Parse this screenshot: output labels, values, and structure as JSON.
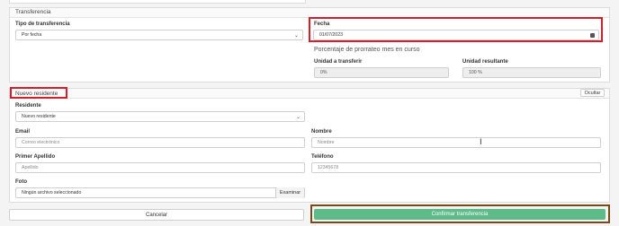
{
  "transfer": {
    "section_title": "Transferencia",
    "tipo_label": "Tipo de transferencia",
    "tipo_value": "Por fecha",
    "fecha_label": "Fecha",
    "fecha_value": "01/07/2023",
    "prorrateo_text": "Porcentaje de prorrateo mes en curso",
    "unidad_transferir_label": "Unidad a transferir",
    "unidad_transferir_value": "0%",
    "unidad_resultante_label": "Unidad resultante",
    "unidad_resultante_value": "100 %"
  },
  "resident": {
    "section_title": "Nuevo residente",
    "hide_label": "Ocultar",
    "residente_label": "Residente",
    "residente_value": "Nuevo residente",
    "email_label": "Email",
    "email_placeholder": "Correo electrónico",
    "nombre_label": "Nombre",
    "nombre_placeholder": "Nombre",
    "apellido_label": "Primer Apellido",
    "apellido_placeholder": "Apellido",
    "telefono_label": "Teléfono",
    "telefono_placeholder": "12345678",
    "foto_label": "Foto",
    "foto_value": "Ningún archivo seleccionado",
    "browse_label": "Examinar"
  },
  "actions": {
    "cancel_label": "Cancelar",
    "confirm_label": "Confirmar transferencia"
  },
  "colors": {
    "highlight": "#d21f2a",
    "confirm_bg": "#5dbb8a",
    "confirm_outline": "#7a4a1a"
  }
}
